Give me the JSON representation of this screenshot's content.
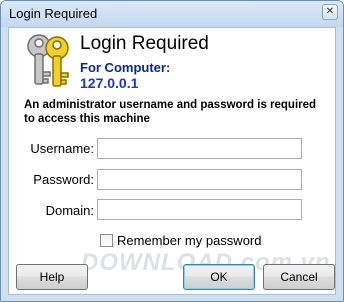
{
  "window": {
    "title": "Login Required",
    "close_glyph": "✕"
  },
  "header": {
    "heading": "Login Required",
    "for_computer_label": "For Computer:",
    "computer": "127.0.0.1",
    "icon": "keys-icon"
  },
  "description": "An administrator username and password is required to access this machine",
  "form": {
    "username_label": "Username:",
    "username_value": "",
    "password_label": "Password:",
    "password_value": "",
    "domain_label": "Domain:",
    "domain_value": "",
    "remember_label": "Remember my password",
    "remember_checked": false
  },
  "buttons": {
    "help": "Help",
    "ok": "OK",
    "cancel": "Cancel"
  },
  "watermark": "DOWNLOAD.com.vn",
  "colors": {
    "heading_blue": "#1d36c8",
    "titlebar": "#c3d8ee"
  }
}
